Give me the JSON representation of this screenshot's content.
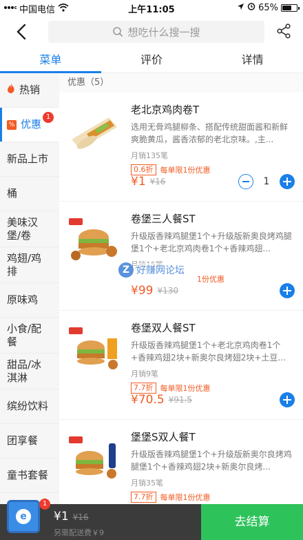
{
  "status_bar": {
    "carrier": "中国电信",
    "time": "上午11:05",
    "battery": "65%",
    "battery_level": 0.65
  },
  "header": {
    "search_placeholder": "想吃什么搜一搜"
  },
  "tabs": [
    {
      "label": "菜单",
      "active": true
    },
    {
      "label": "评价",
      "active": false
    },
    {
      "label": "详情",
      "active": false
    }
  ],
  "sidebar": {
    "items": [
      {
        "label": "热销",
        "icon": "flame-icon"
      },
      {
        "label": "优惠",
        "icon": "discount-icon",
        "badge": "1",
        "active": true
      },
      {
        "label": "新品上市"
      },
      {
        "label": "桶"
      },
      {
        "label": "美味汉堡/卷"
      },
      {
        "label": "鸡翅/鸡排"
      },
      {
        "label": "原味鸡"
      },
      {
        "label": "小食/配餐"
      },
      {
        "label": "甜品/冰淇淋"
      },
      {
        "label": "缤纷饮料"
      },
      {
        "label": "团享餐"
      },
      {
        "label": "童书套餐"
      }
    ]
  },
  "section": {
    "title": "优惠（5）"
  },
  "products": [
    {
      "name": "老北京鸡肉卷T",
      "desc": "选用无骨鸡腿柳条、搭配传统甜面酱和新鲜爽脆黄瓜，酱香浓郁的老北京味。,主...",
      "sold": "月销135笔",
      "discount": "0.6折",
      "limit": "每单限1份优惠",
      "price": "¥1",
      "orig": "¥16",
      "qty": "1"
    },
    {
      "name": "卷堡三人餐ST",
      "desc": "升级版香辣鸡腿堡1个+升级版新奥良烤鸡腿堡1个+老北京鸡肉卷1个+香辣鸡翅...",
      "sold": "月销15笔",
      "discount": "",
      "limit": "1份优惠",
      "price": "¥99",
      "orig": "¥130"
    },
    {
      "name": "卷堡双人餐ST",
      "desc": "升级版香辣鸡腿堡1个+老北京鸡肉卷1个+香辣鸡翅2块+新奥尔良烤翅2块+土豆...",
      "sold": "月销9笔",
      "discount": "7.7折",
      "limit": "每单限1份优惠",
      "price": "¥70.5",
      "orig": "¥91.5"
    },
    {
      "name": "堡堡S双人餐T",
      "desc": "升级版香辣鸡腿堡1个+升级版新奥尔良烤鸡腿堡1个+香辣鸡翅2块+新奥尔良烤...",
      "sold": "月销35笔",
      "discount": "7.7折",
      "limit": "每单限1份优惠",
      "price": "",
      "orig": ""
    }
  ],
  "watermark": {
    "letter": "Z",
    "text": "好赚网论坛"
  },
  "cart": {
    "badge": "1",
    "total": "¥1",
    "orig": "¥16",
    "fee": "另需配送费￥9",
    "checkout": "去结算"
  },
  "colors": {
    "accent": "#1a7fe8",
    "price": "#f25b24",
    "checkout": "#2ec25b"
  }
}
